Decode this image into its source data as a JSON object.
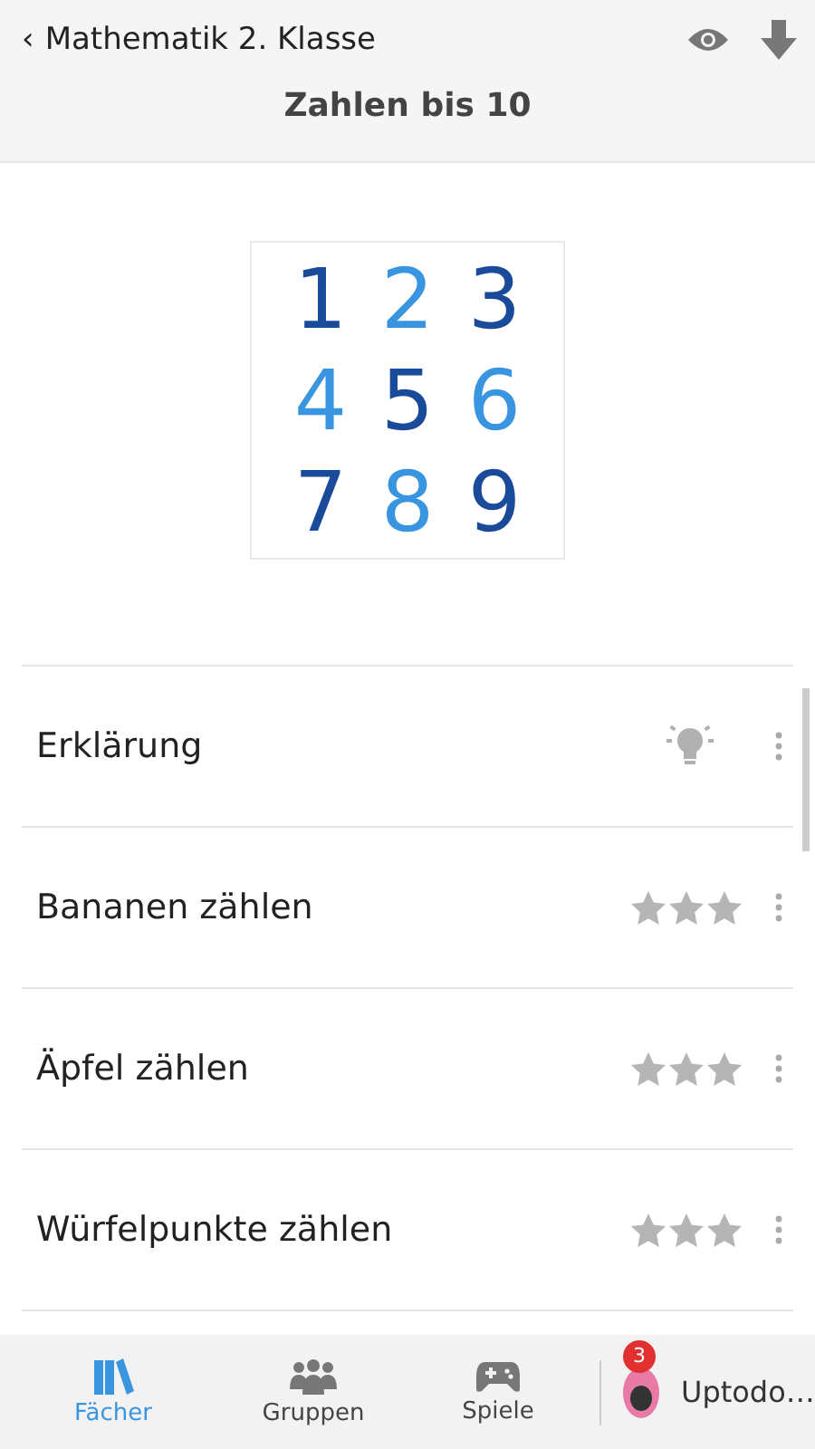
{
  "header": {
    "back": "‹",
    "parent": "Mathematik 2. Klasse",
    "title": "Zahlen bis 10"
  },
  "digits": [
    {
      "text": "1",
      "color": "#1a4a9a"
    },
    {
      "text": "2",
      "color": "#3a95e0"
    },
    {
      "text": "3",
      "color": "#1a4a9a"
    },
    {
      "text": "4",
      "color": "#3a95e0"
    },
    {
      "text": "5",
      "color": "#1a4a9a"
    },
    {
      "text": "6",
      "color": "#3a95e0"
    },
    {
      "text": "7",
      "color": "#1a4a9a"
    },
    {
      "text": "8",
      "color": "#3a95e0"
    },
    {
      "text": "9",
      "color": "#1a4a9a"
    }
  ],
  "lessons": [
    {
      "kind": "explanation",
      "label": "Erklärung"
    },
    {
      "kind": "exercise",
      "label": "Bananen zählen",
      "stars": 0
    },
    {
      "kind": "exercise",
      "label": "Äpfel zählen",
      "stars": 0
    },
    {
      "kind": "exercise",
      "label": "Würfelpunkte zählen",
      "stars": 0
    }
  ],
  "nav": [
    {
      "kind": "books",
      "label": "Fächer",
      "selected": true
    },
    {
      "kind": "groups",
      "label": "Gruppen",
      "selected": false
    },
    {
      "kind": "games",
      "label": "Spiele",
      "selected": false
    }
  ],
  "profile": {
    "name": "Uptodo…",
    "badge": "3"
  }
}
